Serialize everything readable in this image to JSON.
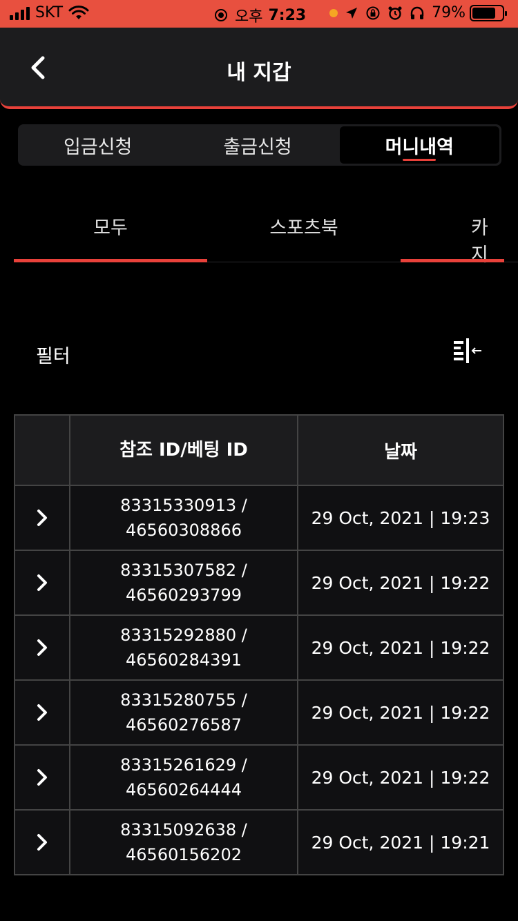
{
  "status_bar": {
    "carrier": "SKT",
    "period": "오후",
    "time": "7:23",
    "battery": "79%",
    "battery_level": 0.79,
    "icons": [
      "signal-icon",
      "wifi-icon",
      "location-icon",
      "orientation-lock-icon",
      "alarm-icon",
      "headphones-icon",
      "battery-icon"
    ]
  },
  "header": {
    "title": "내 지갑",
    "back_icon": "chevron-left-icon"
  },
  "segments": [
    {
      "label": "입금신청",
      "active": false
    },
    {
      "label": "출금신청",
      "active": false
    },
    {
      "label": "머니내역",
      "active": true
    }
  ],
  "tabs": [
    {
      "label": "모두",
      "active": true
    },
    {
      "label": "스포츠북",
      "active": false
    },
    {
      "label": "카지",
      "active": true
    }
  ],
  "filter": {
    "label": "필터",
    "icon": "filter-collapse-icon"
  },
  "table": {
    "headers": [
      "",
      "참조 ID/베팅 ID",
      "날짜"
    ],
    "rows": [
      {
        "ref_id": "83315330913 /",
        "bet_id": "46560308866",
        "date": "29 Oct, 2021 | 19:23"
      },
      {
        "ref_id": "83315307582 /",
        "bet_id": "46560293799",
        "date": "29 Oct, 2021 | 19:22"
      },
      {
        "ref_id": "83315292880 /",
        "bet_id": "46560284391",
        "date": "29 Oct, 2021 | 19:22"
      },
      {
        "ref_id": "83315280755 /",
        "bet_id": "46560276587",
        "date": "29 Oct, 2021 | 19:22"
      },
      {
        "ref_id": "83315261629 /",
        "bet_id": "46560264444",
        "date": "29 Oct, 2021 | 19:22"
      },
      {
        "ref_id": "83315092638 /",
        "bet_id": "46560156202",
        "date": "29 Oct, 2021 | 19:21"
      }
    ]
  },
  "colors": {
    "accent": "#e8413a",
    "status_bar": "#e8503f",
    "background": "#000000",
    "surface": "#1c1c1e"
  }
}
